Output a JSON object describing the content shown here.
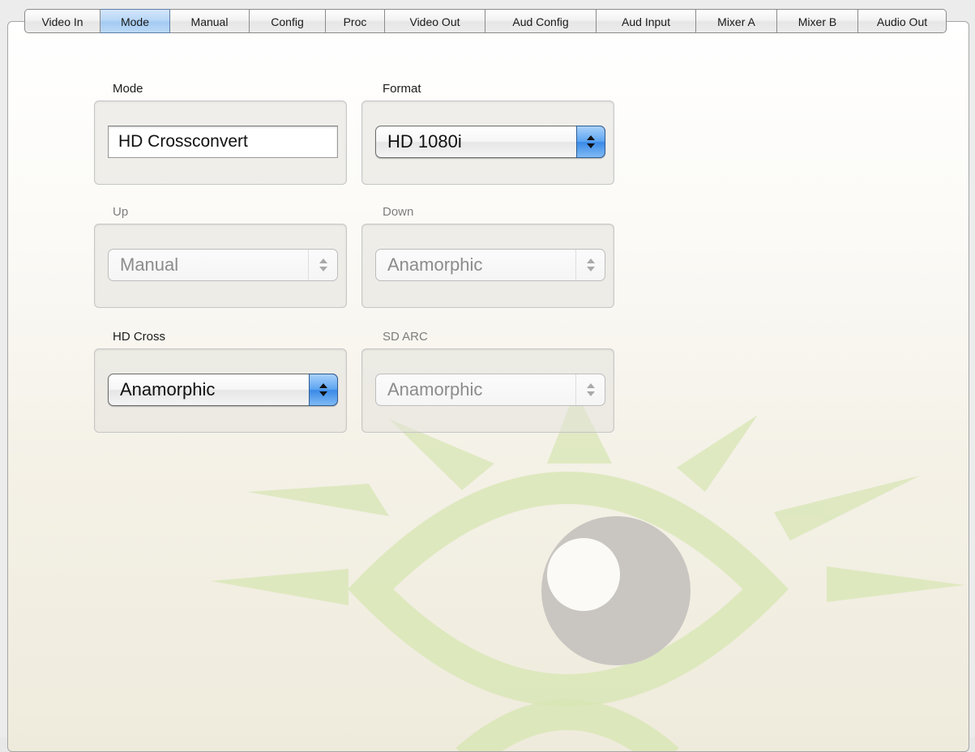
{
  "tabs": [
    {
      "label": "Video In",
      "active": false
    },
    {
      "label": "Mode",
      "active": true
    },
    {
      "label": "Manual",
      "active": false
    },
    {
      "label": "Config",
      "active": false
    },
    {
      "label": "Proc",
      "active": false
    },
    {
      "label": "Video Out",
      "active": false
    },
    {
      "label": "Aud Config",
      "active": false
    },
    {
      "label": "Aud Input",
      "active": false
    },
    {
      "label": "Mixer A",
      "active": false
    },
    {
      "label": "Mixer B",
      "active": false
    },
    {
      "label": "Audio Out",
      "active": false
    }
  ],
  "mode": {
    "label": "Mode",
    "value": "HD Crossconvert"
  },
  "format": {
    "label": "Format",
    "value": "HD 1080i",
    "enabled": true
  },
  "up": {
    "label": "Up",
    "value": "Manual",
    "enabled": false
  },
  "down": {
    "label": "Down",
    "value": "Anamorphic",
    "enabled": false
  },
  "hd_cross": {
    "label": "HD Cross",
    "value": "Anamorphic",
    "enabled": true
  },
  "sd_arc": {
    "label": "SD ARC",
    "value": "Anamorphic",
    "enabled": false
  },
  "colors": {
    "active_tab": "#b9d7f7",
    "stepper_blue": "#3b8ae8",
    "watermark_green": "#d8e6b4",
    "watermark_gray": "#c9c6c2"
  }
}
